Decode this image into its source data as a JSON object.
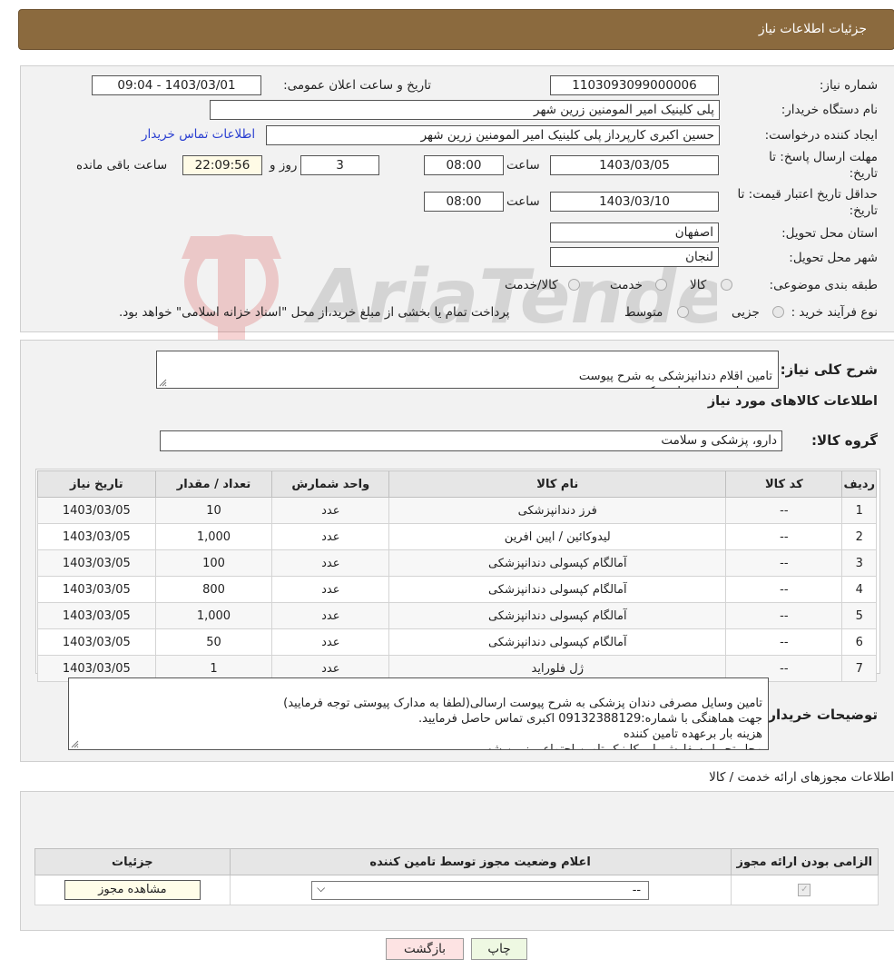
{
  "header": {
    "title": "جزئیات اطلاعات نیاز"
  },
  "info": {
    "need_number_label": "شماره نیاز:",
    "need_number": "1103093099000006",
    "announce_label": "تاریخ و ساعت اعلان عمومی:",
    "announce_value": "1403/03/01 - 09:04",
    "buyer_label": "نام دستگاه خریدار:",
    "buyer_value": "پلی کلینیک امیر المومنین زرین شهر",
    "creator_label": "ایجاد کننده درخواست:",
    "creator_value": "حسین اکبری کارپرداز پلی کلینیک امیر المومنین زرین شهر",
    "contact_link": "اطلاعات تماس خریدار",
    "deadline_label_1": "مهلت ارسال پاسخ: تا",
    "deadline_label_2": "تاریخ:",
    "deadline_date": "1403/03/05",
    "time_label": "ساعت",
    "deadline_time": "08:00",
    "days_value": "3",
    "days_label": "روز و",
    "remaining_time": "22:09:56",
    "remaining_label": "ساعت باقی مانده",
    "validity_label_1": "حداقل تاریخ اعتبار قیمت: تا",
    "validity_label_2": "تاریخ:",
    "validity_date": "1403/03/10",
    "validity_time": "08:00",
    "province_label": "استان محل تحویل:",
    "province_value": "اصفهان",
    "city_label": "شهر محل تحویل:",
    "city_value": "لنجان",
    "category_label": "طبقه بندی موضوعی:",
    "category_options": [
      "کالا",
      "خدمت",
      "کالا/خدمت"
    ],
    "process_label": "نوع فرآیند خرید :",
    "process_options": [
      "جزیی",
      "متوسط"
    ],
    "payment_note": "پرداخت تمام یا بخشی از مبلغ خرید،از محل \"اسناد خزانه اسلامی\" خواهد بود."
  },
  "description": {
    "label": "شرح کلی نیاز:",
    "text": "تامین اقلام دندانپزشکی به شرح پیوست\nهزینه بار بر عهده تامین کننده"
  },
  "goods": {
    "section_title": "اطلاعات کالاهای مورد نیاز",
    "group_label": "گروه کالا:",
    "group_value": "دارو، پزشکی و سلامت",
    "columns": [
      "ردیف",
      "کد کالا",
      "نام کالا",
      "واحد شمارش",
      "تعداد / مقدار",
      "تاریخ نیاز"
    ],
    "rows": [
      [
        "1",
        "--",
        "فرز دندانپزشکی",
        "عدد",
        "10",
        "1403/03/05"
      ],
      [
        "2",
        "--",
        "لیدوکائین / اپین افرین",
        "عدد",
        "1,000",
        "1403/03/05"
      ],
      [
        "3",
        "--",
        "آمالگام کپسولی دندانپزشکی",
        "عدد",
        "100",
        "1403/03/05"
      ],
      [
        "4",
        "--",
        "آمالگام کپسولی دندانپزشکی",
        "عدد",
        "800",
        "1403/03/05"
      ],
      [
        "5",
        "--",
        "آمالگام کپسولی دندانپزشکی",
        "عدد",
        "1,000",
        "1403/03/05"
      ],
      [
        "6",
        "--",
        "آمالگام کپسولی دندانپزشکی",
        "عدد",
        "50",
        "1403/03/05"
      ],
      [
        "7",
        "--",
        "ژل فلوراید",
        "عدد",
        "1",
        "1403/03/05"
      ]
    ]
  },
  "buyer_notes": {
    "label": "توضیحات خریدار:",
    "text": "تامین وسایل مصرفی دندان پزشکی به شرح پیوست ارسالی(لطفا به مدارک پیوستی توجه فرمایید)\nجهت هماهنگی با شماره:09132388129 اکبری تماس حاصل فرمایید.\nهزینه بار برعهده تامین کننده\nمحل تحویل سفارش پلی کلینیک تامین اجتماعی زرین شهر"
  },
  "permits": {
    "section_title": "اطلاعات مجوزهای ارائه خدمت / کالا",
    "columns": [
      "الزامی بودن ارائه مجوز",
      "اعلام وضعیت مجوز توسط تامین کننده",
      "جزئیات"
    ],
    "select_value": "--",
    "view_button": "مشاهده مجوز"
  },
  "buttons": {
    "back": "بازگشت",
    "print": "چاپ"
  },
  "watermark": {
    "text": "AriaTender.neT"
  }
}
